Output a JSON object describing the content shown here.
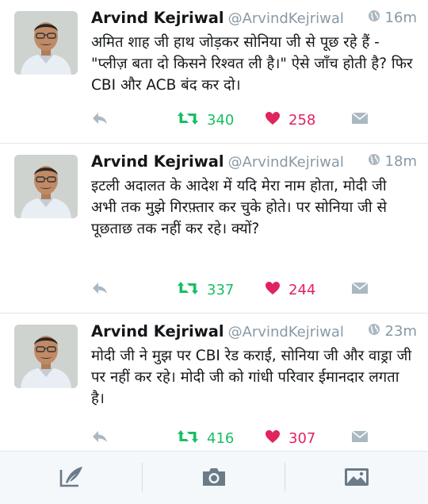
{
  "colors": {
    "retweet_green": "#17bf63",
    "like_red": "#e0245e",
    "meta_gray": "#8899a6",
    "text_dark": "#14171a"
  },
  "tweets": [
    {
      "name": "Arvind Kejriwal",
      "handle": "@ArvindKejriwal",
      "time": "16m",
      "text": "अमित शाह जी हाथ जोड़कर सोनिया जी से पूछ रहे हैं - \"प्लीज़ बता दो किसने रिश्वत ली है।\" ऐसे जाँच होती है? फिर CBI और ACB बंद कर दो।",
      "retweets": "340",
      "likes": "258"
    },
    {
      "name": "Arvind Kejriwal",
      "handle": "@ArvindKejriwal",
      "time": "18m",
      "text": "इटली अदालत के आदेश में यदि मेरा नाम होता, मोदी जी अभी तक मुझे गिरफ़्तार कर चुके होते। पर सोनिया जी से पूछताछ तक नहीं कर रहे। क्यों?",
      "retweets": "337",
      "likes": "244"
    },
    {
      "name": "Arvind Kejriwal",
      "handle": "@ArvindKejriwal",
      "time": "23m",
      "text": "मोदी जी ने मुझ पर CBI रेड कराई, सोनिया जी और वाड्रा जी पर नहीं कर रहे। मोदी जी को गांधी परिवार ईमानदार लगता है।",
      "retweets": "416",
      "likes": "307"
    }
  ],
  "icons": {
    "reply": "reply-icon",
    "retweet": "retweet-icon",
    "like": "heart-icon",
    "dm": "direct-message-icon",
    "globe": "globe-icon",
    "compose": "compose-tweet-icon",
    "camera": "camera-icon",
    "gallery": "image-gallery-icon"
  }
}
